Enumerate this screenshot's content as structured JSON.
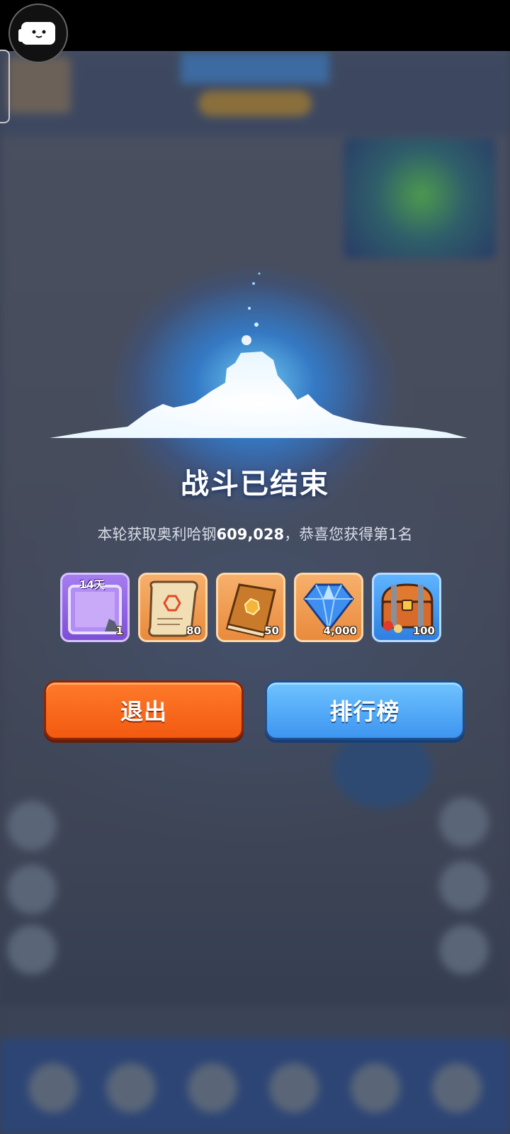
{
  "result": {
    "title": "战斗已结束",
    "subtitle_prefix": "本轮获取奥利哈钢",
    "amount": "609,028",
    "subtitle_suffix": "，恭喜您获得第1名"
  },
  "rewards": [
    {
      "icon": "avatar-frame-icon",
      "badge": "14天",
      "qty": "1",
      "rarity_color": "#9b6cf0"
    },
    {
      "icon": "scroll-icon",
      "qty": "80",
      "rarity_color": "#f0a050"
    },
    {
      "icon": "book-icon",
      "qty": "50",
      "rarity_color": "#f0a050"
    },
    {
      "icon": "diamond-icon",
      "qty": "4,000",
      "rarity_color": "#f0a050"
    },
    {
      "icon": "treasure-chest-icon",
      "qty": "100",
      "rarity_color": "#4a9cf5"
    }
  ],
  "buttons": {
    "exit_label": "退出",
    "leaderboard_label": "排行榜"
  },
  "colors": {
    "exit_button": "#f25a10",
    "leaderboard_button": "#3d95f0"
  }
}
